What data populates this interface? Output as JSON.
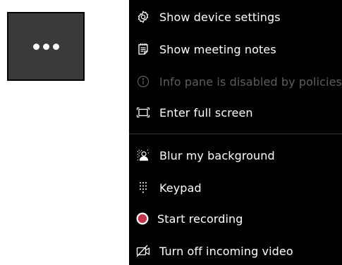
{
  "more_button": {
    "icon": "more-dots-icon"
  },
  "menu": {
    "items": [
      {
        "label": "Show device settings",
        "icon": "gear-icon",
        "enabled": true
      },
      {
        "label": "Show meeting notes",
        "icon": "notes-icon",
        "enabled": true
      },
      {
        "label": "Info pane is disabled by policies",
        "icon": "info-icon",
        "enabled": false
      },
      {
        "label": "Enter full screen",
        "icon": "fullscreen-icon",
        "enabled": true
      },
      {
        "label": "Blur my background",
        "icon": "blur-background-icon",
        "enabled": true
      },
      {
        "label": "Keypad",
        "icon": "keypad-icon",
        "enabled": true
      },
      {
        "label": "Start recording",
        "icon": "record-icon",
        "enabled": true
      },
      {
        "label": "Turn off incoming video",
        "icon": "video-off-icon",
        "enabled": true
      }
    ]
  },
  "colors": {
    "menu_bg": "#000000",
    "button_bg": "#3b3a39",
    "text": "#ffffff",
    "disabled_text": "#605e5c",
    "record": "#c4314b",
    "divider": "#3b3a39"
  }
}
